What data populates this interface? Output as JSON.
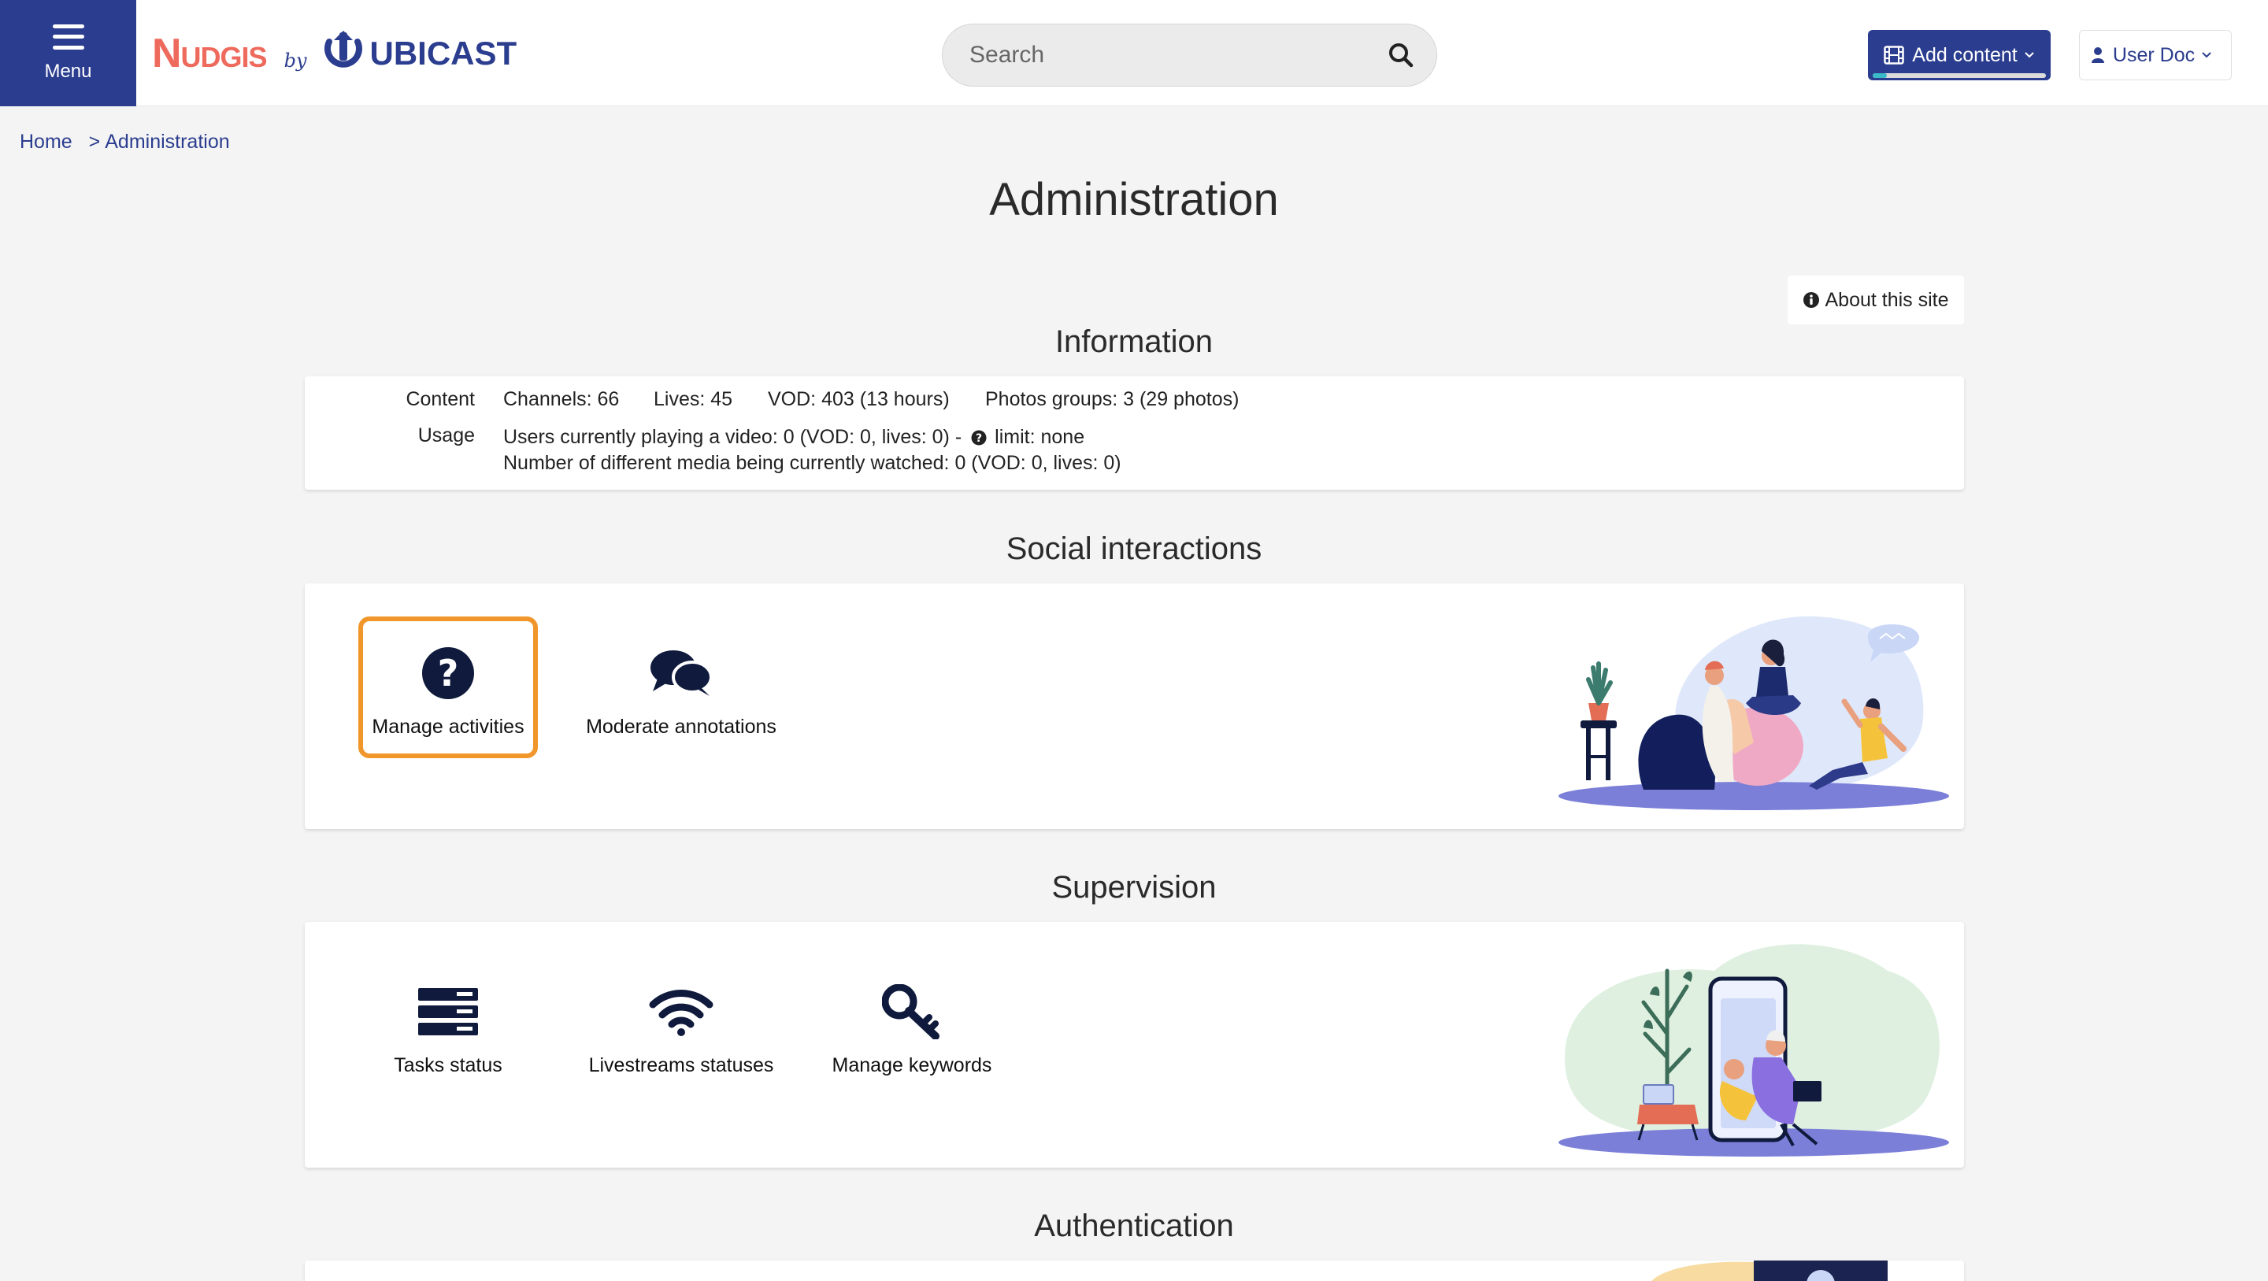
{
  "header": {
    "menu_label": "Menu",
    "logo_text": "Nudgis",
    "logo_by": "by",
    "logo_company": "UBICAST",
    "search_placeholder": "Search",
    "add_content_label": "Add content",
    "user_label": "User Doc",
    "brand_color": "#2b3d8f",
    "logo_accent": "#ee6a5c"
  },
  "breadcrumb": {
    "home": "Home",
    "separator": ">",
    "current": "Administration"
  },
  "page": {
    "title": "Administration",
    "about_label": "About this site"
  },
  "information": {
    "title": "Information",
    "content_label": "Content",
    "channels": "Channels: 66",
    "lives": "Lives: 45",
    "vod": "VOD: 403 (13 hours)",
    "photos": "Photos groups: 3 (29 photos)",
    "usage_label": "Usage",
    "usage_line1": "Users currently playing a video: 0 (VOD: 0, lives: 0) -",
    "usage_limit": "limit: none",
    "usage_line2": "Number of different media being currently watched: 0 (VOD: 0, lives: 0)"
  },
  "social": {
    "title": "Social interactions",
    "items": [
      {
        "label": "Manage activities",
        "icon": "question-circle-icon"
      },
      {
        "label": "Moderate annotations",
        "icon": "comments-icon"
      }
    ]
  },
  "supervision": {
    "title": "Supervision",
    "items": [
      {
        "label": "Tasks status",
        "icon": "server-icon"
      },
      {
        "label": "Livestreams statuses",
        "icon": "wifi-icon"
      },
      {
        "label": "Manage keywords",
        "icon": "key-icon"
      }
    ]
  },
  "authentication": {
    "title": "Authentication"
  },
  "colors": {
    "focus_outline": "#f0962b",
    "icon_navy": "#0f1a3c"
  }
}
